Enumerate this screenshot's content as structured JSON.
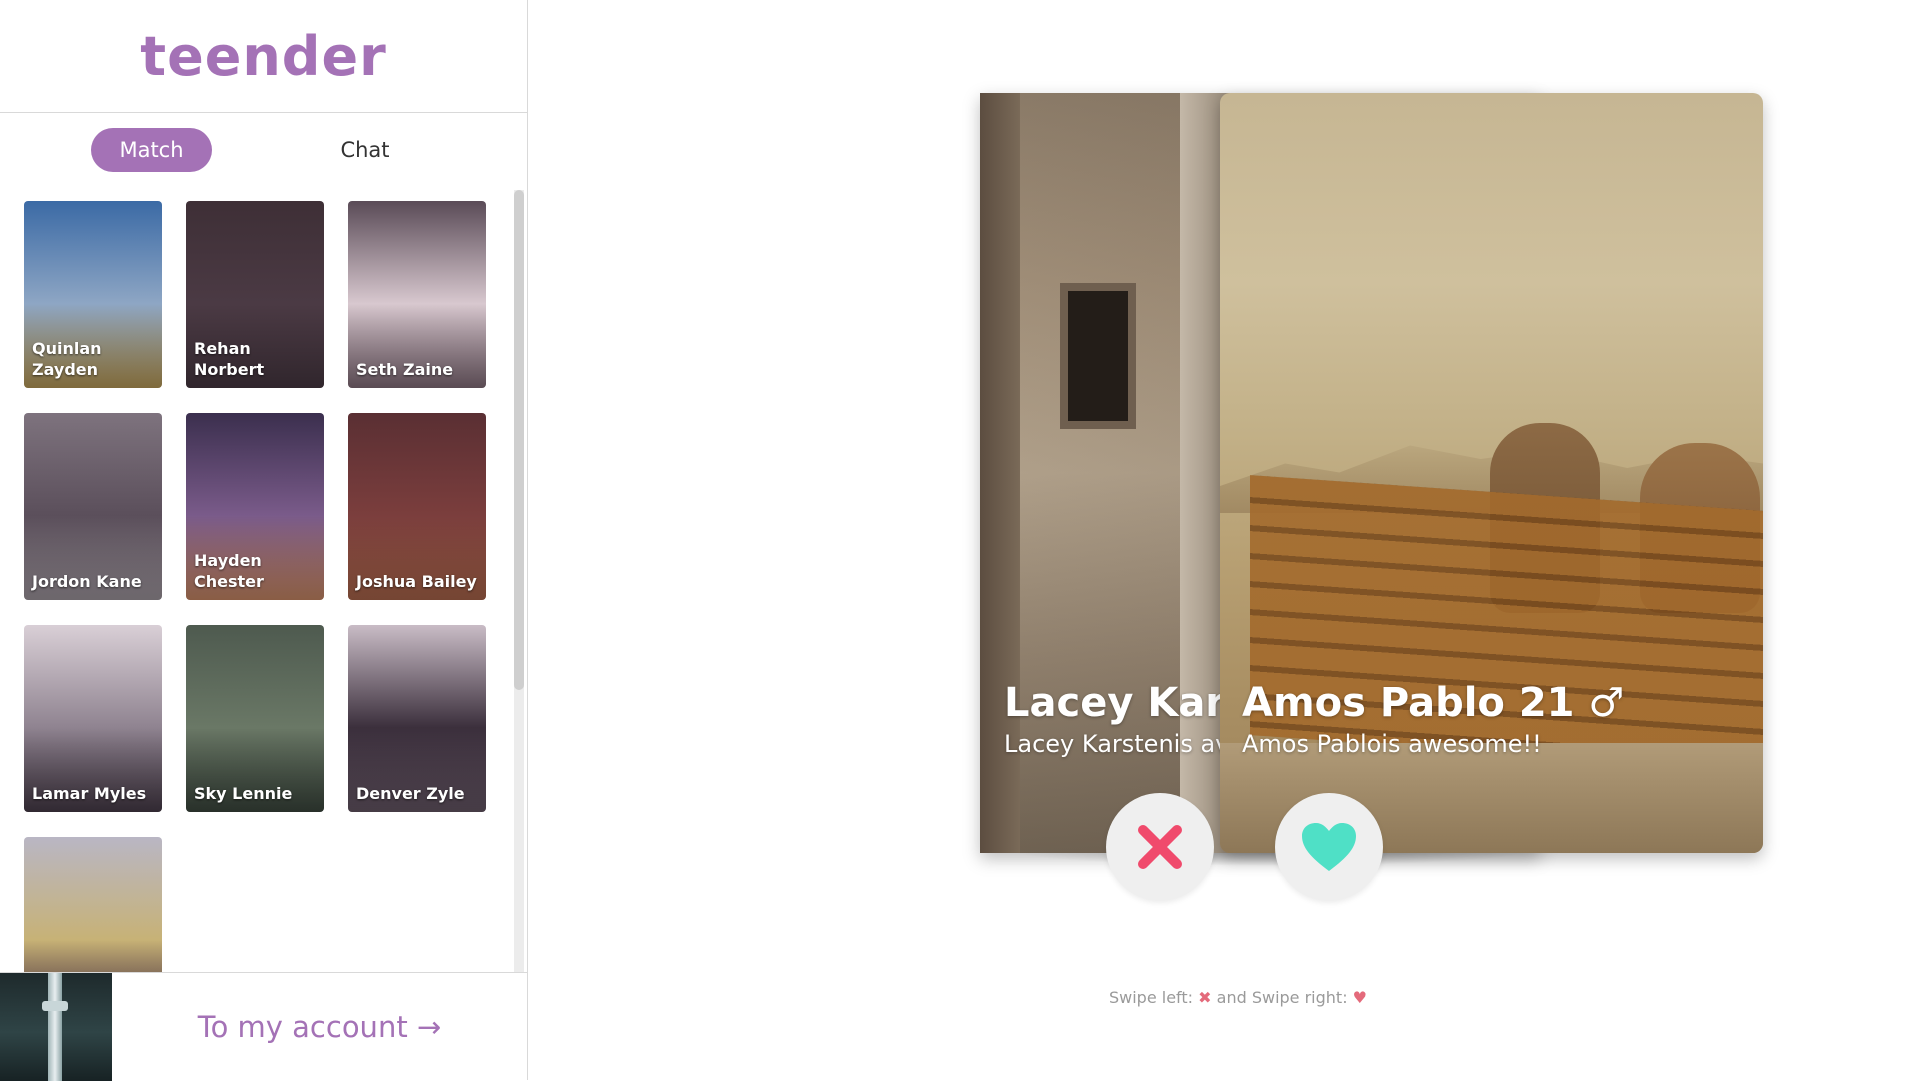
{
  "app": {
    "brand": "teender"
  },
  "tabs": [
    {
      "label": "Match",
      "active": true
    },
    {
      "label": "Chat",
      "active": false
    }
  ],
  "matches": [
    {
      "name": "Quinlan Zayden",
      "palette": [
        "#3b6aa5",
        "#8ea6c4",
        "#c3a35c"
      ]
    },
    {
      "name": "Rehan Norbert",
      "palette": [
        "#3e2f36",
        "#4b3a44",
        "#4a3a44"
      ]
    },
    {
      "name": "Seth Zaine",
      "palette": [
        "#5a4b57",
        "#d8c8cf",
        "#8a7480"
      ]
    },
    {
      "name": "Jordon Kane",
      "palette": [
        "#7e737e",
        "#5b4f5b",
        "#a79ea6"
      ]
    },
    {
      "name": "Hayden Chester",
      "palette": [
        "#3b2f4e",
        "#7a5b8a",
        "#d38f6a"
      ]
    },
    {
      "name": "Joshua Bailey",
      "palette": [
        "#5a2f33",
        "#7b3e3d",
        "#b36a4e"
      ]
    },
    {
      "name": "Lamar Myles",
      "palette": [
        "#d9cfd6",
        "#8f8390",
        "#4b3f4c"
      ]
    },
    {
      "name": "Sky Lennie",
      "palette": [
        "#4e5a4f",
        "#6a7866",
        "#3e4a40"
      ]
    },
    {
      "name": "Denver Zyle",
      "palette": [
        "#c9bcc6",
        "#3b2f3c",
        "#6b5b6a"
      ]
    },
    {
      "name": "",
      "palette": [
        "#b9b6c4",
        "#c7b276",
        "#5c3b54"
      ]
    }
  ],
  "account": {
    "link_label": "To my account  →"
  },
  "cards": {
    "back": {
      "title": "Lacey Karst",
      "subtitle": "Lacey Karstenis av"
    },
    "front": {
      "title": "Amos Pablo 21 ♂",
      "subtitle": "Amos Pablois awesome!!"
    }
  },
  "actions": {
    "reject_icon": "close-icon",
    "like_icon": "heart-icon",
    "reject_color": "#f04a6c",
    "like_color": "#4fe0c6"
  },
  "hint": {
    "text_a": "Swipe left: ",
    "text_b": " and Swipe right: "
  },
  "colors": {
    "accent": "#a472b6"
  }
}
